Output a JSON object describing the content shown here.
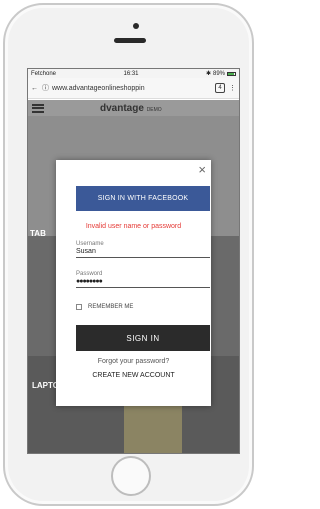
{
  "device": {
    "carrier": "Fetchone",
    "time": "16:31",
    "battery": "89%"
  },
  "browser": {
    "url": "www.advantageonlineshoppin",
    "tabs": "4"
  },
  "site": {
    "brand": "dvantage",
    "brand_suffix": "DEMO",
    "categories": [
      "TAB",
      "LAPTOPS"
    ]
  },
  "login": {
    "facebook_label": "SIGN IN WITH FACEBOOK",
    "error": "Invalid user name or password",
    "username_label": "Username",
    "username_value": "Susan",
    "password_label": "Password",
    "password_value": "●●●●●●●●",
    "remember_label": "REMEMBER ME",
    "signin_label": "SIGN IN",
    "forgot_label": "Forgot your password?",
    "create_label": "CREATE NEW ACCOUNT"
  }
}
